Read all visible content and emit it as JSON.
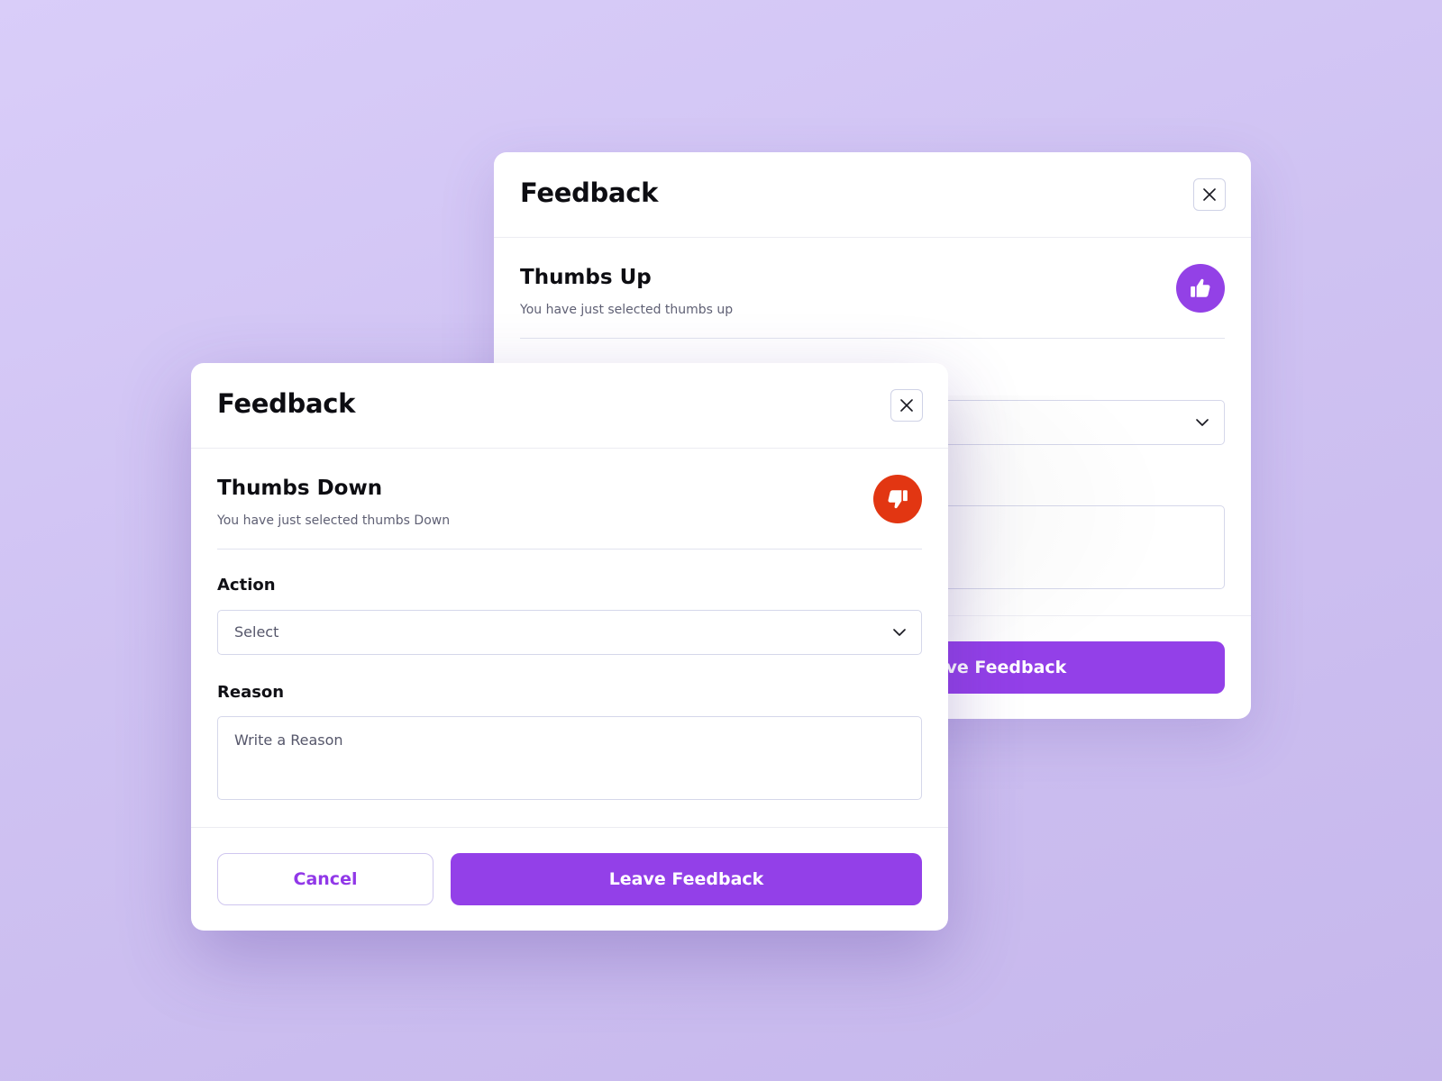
{
  "back_modal": {
    "title": "Feedback",
    "section_title": "Thumbs Up",
    "section_subtitle": "You have just selected thumbs up",
    "primary_label": "Leave Feedback",
    "badge_color": "#9341e6"
  },
  "front_modal": {
    "title": "Feedback",
    "section_title": "Thumbs Down",
    "section_subtitle": "You have just selected thumbs Down",
    "action_label": "Action",
    "action_value": "Select",
    "reason_label": "Reason",
    "reason_placeholder": "Write a Reason",
    "cancel_label": "Cancel",
    "primary_label": "Leave Feedback",
    "badge_color": "#e23612"
  },
  "icons": {
    "close": "close-icon",
    "thumbs_up": "thumbs-up-icon",
    "thumbs_down": "thumbs-down-icon",
    "chevron": "chevron-down-icon"
  },
  "colors": {
    "accent": "#9340e8",
    "danger": "#e23612"
  }
}
